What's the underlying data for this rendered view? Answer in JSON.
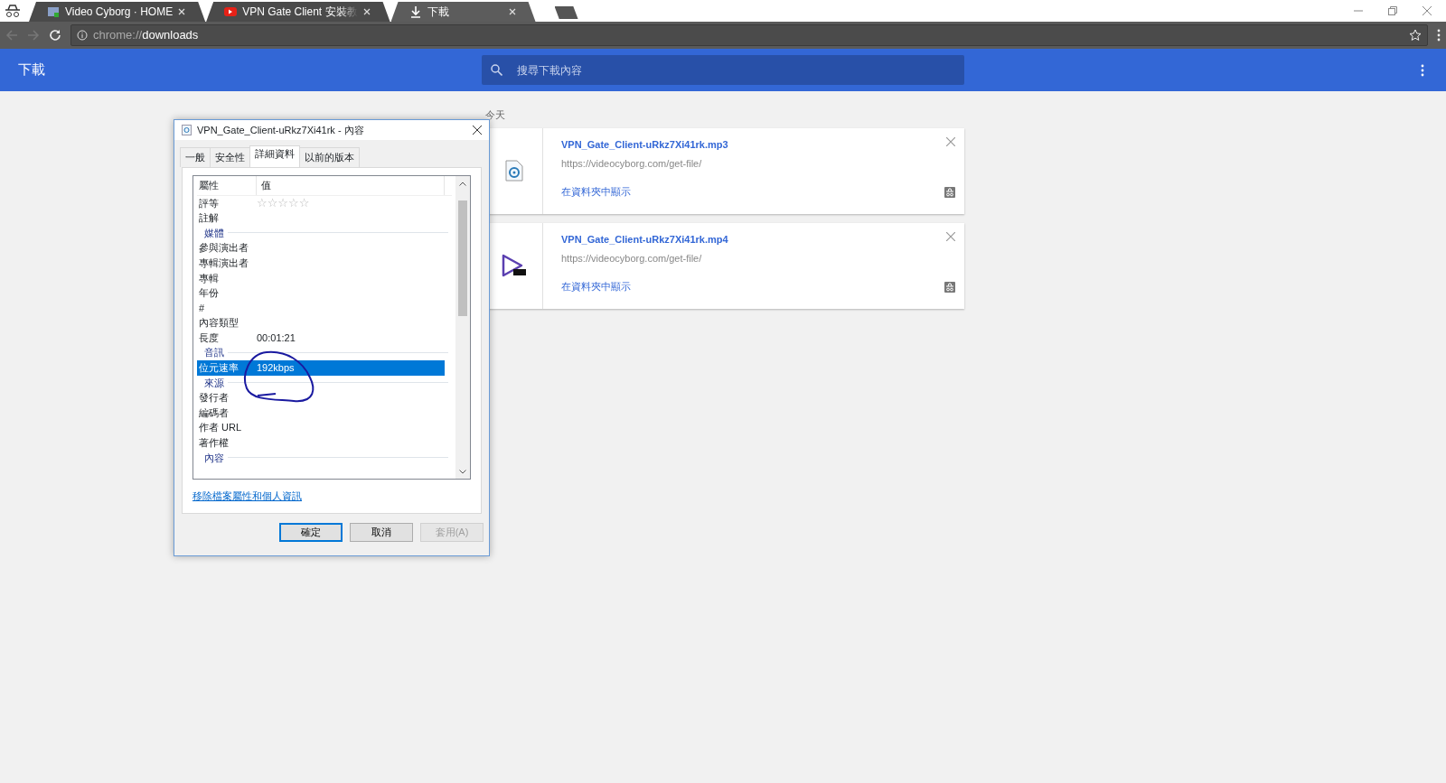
{
  "browser": {
    "tabs": [
      {
        "title": "Video Cyborg · HOME",
        "kind": "site",
        "selected": false
      },
      {
        "title": "VPN Gate Client 安裝教",
        "kind": "video",
        "selected": false
      },
      {
        "title": "下載",
        "kind": "download",
        "selected": true
      }
    ],
    "address": {
      "scheme": "chrome://",
      "path": "downloads"
    }
  },
  "header": {
    "title": "下載",
    "search": {
      "placeholder": "搜尋下載內容"
    }
  },
  "date_heading": "今天",
  "downloads": [
    {
      "name": "VPN_Gate_Client-uRkz7Xi41rk.mp3",
      "url": "https://videocyborg.com/get-file/",
      "action": "在資料夾中顯示",
      "kind": "audio"
    },
    {
      "name": "VPN_Gate_Client-uRkz7Xi41rk.mp4",
      "url": "https://videocyborg.com/get-file/",
      "action": "在資料夾中顯示",
      "kind": "video"
    }
  ],
  "dialog": {
    "title": "VPN_Gate_Client-uRkz7Xi41rk - 內容",
    "tabs": [
      {
        "label": "一般",
        "selected": false
      },
      {
        "label": "安全性",
        "selected": false
      },
      {
        "label": "詳細資料",
        "selected": true
      },
      {
        "label": "以前的版本",
        "selected": false
      }
    ],
    "columns": [
      "屬性",
      "值"
    ],
    "rows": [
      {
        "kind": "rating",
        "name": "評等",
        "stars": 0,
        "selected": false
      },
      {
        "kind": "property",
        "name": "註解",
        "selected": false
      },
      {
        "kind": "group",
        "name": "媒體"
      },
      {
        "kind": "property",
        "name": "參與演出者",
        "selected": false
      },
      {
        "kind": "property",
        "name": "專輯演出者",
        "selected": false
      },
      {
        "kind": "property",
        "name": "專輯",
        "selected": false
      },
      {
        "kind": "property",
        "name": "年份",
        "selected": false
      },
      {
        "kind": "property",
        "name": "#",
        "selected": false
      },
      {
        "kind": "property",
        "name": "內容類型",
        "selected": false
      },
      {
        "kind": "property",
        "name": "長度",
        "value": "00:01:21",
        "selected": false
      },
      {
        "kind": "group",
        "name": "音訊"
      },
      {
        "kind": "property",
        "name": "位元速率",
        "value": "192kbps",
        "selected": true
      },
      {
        "kind": "group",
        "name": "來源"
      },
      {
        "kind": "property",
        "name": "發行者",
        "selected": false
      },
      {
        "kind": "property",
        "name": "編碼者",
        "selected": false
      },
      {
        "kind": "property",
        "name": "作者 URL",
        "selected": false
      },
      {
        "kind": "property",
        "name": "著作權",
        "selected": false
      },
      {
        "kind": "group",
        "name": "內容"
      }
    ],
    "link": "移除檔案屬性和個人資訊",
    "buttons": [
      {
        "label": "確定",
        "kind": "default",
        "disabled": false
      },
      {
        "label": "取消",
        "kind": "normal",
        "disabled": false
      },
      {
        "label": "套用(A)",
        "kind": "normal",
        "disabled": true
      }
    ]
  }
}
